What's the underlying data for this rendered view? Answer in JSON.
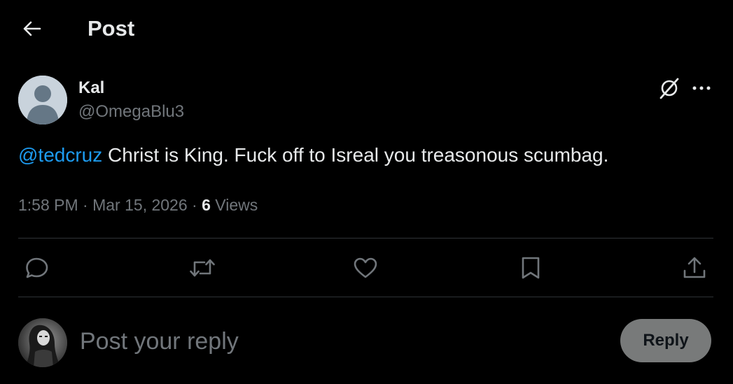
{
  "header": {
    "back_icon": "arrow-left-icon",
    "title": "Post"
  },
  "author": {
    "name": "Kal",
    "handle": "@OmegaBlu3",
    "avatar_icon": "default-avatar-icon"
  },
  "post": {
    "mention": "@tedcruz",
    "body": " Christ is King. Fuck off to Isreal you treasonous scumbag.",
    "time": "1:58 PM",
    "separator": " · ",
    "date": "Mar 15, 2026",
    "views_count": "6",
    "views_label": " Views"
  },
  "actions": {
    "reply_icon": "reply-icon",
    "repost_icon": "repost-icon",
    "like_icon": "heart-icon",
    "bookmark_icon": "bookmark-icon",
    "share_icon": "share-icon"
  },
  "composer": {
    "placeholder": "Post your reply",
    "value": "",
    "reply_button": "Reply"
  },
  "colors": {
    "background": "#000000",
    "text": "#e7e9ea",
    "secondary": "#71767b",
    "link": "#1d9bf0",
    "divider": "#2f3336",
    "reply_button_bg": "#787a7a"
  }
}
